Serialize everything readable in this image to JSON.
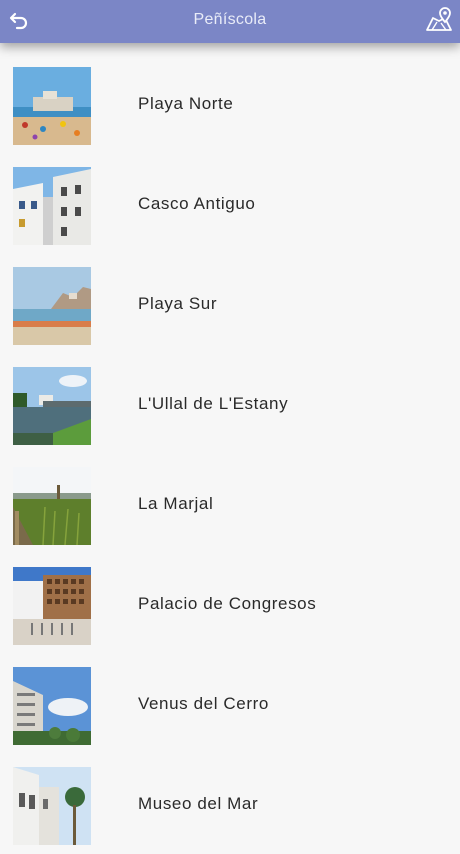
{
  "app_bar": {
    "title": "Peñíscola",
    "back_icon": "back-arrow-icon",
    "map_icon": "map-marker-icon",
    "color": "#7b86c6"
  },
  "places": [
    {
      "label": "Playa Norte",
      "image": "beach-town-photo"
    },
    {
      "label": "Casco Antiguo",
      "image": "white-buildings-photo"
    },
    {
      "label": "Playa Sur",
      "image": "south-beach-photo"
    },
    {
      "label": "L'Ullal de L'Estany",
      "image": "canal-bridge-photo"
    },
    {
      "label": "La Marjal",
      "image": "wetland-photo"
    },
    {
      "label": "Palacio de Congresos",
      "image": "congress-palace-photo"
    },
    {
      "label": "Venus del Cerro",
      "image": "hillside-building-photo"
    },
    {
      "label": "Museo del Mar",
      "image": "museum-street-photo"
    }
  ]
}
